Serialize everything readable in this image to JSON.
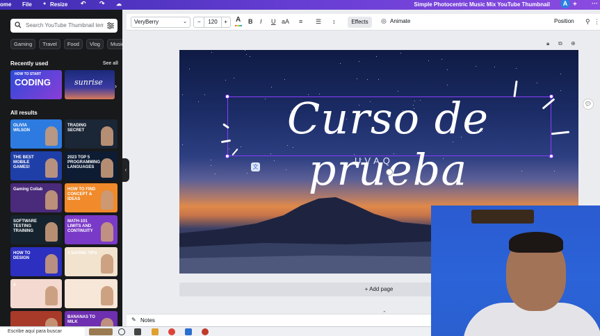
{
  "topbar": {
    "home_label": "ome",
    "file_label": "File",
    "resize_label": "Resize",
    "doc_title": "Simple Photocentric Music Mix YouTube Thumbnail",
    "avatar_letter": "A"
  },
  "left_panel": {
    "search_placeholder": "Search YouTube Thumbnail templ",
    "chips": [
      "Gaming",
      "Travel",
      "Food",
      "Vlog",
      "Music"
    ],
    "recently_used_title": "Recently used",
    "see_all_label": "See all",
    "all_results_title": "All results",
    "recent_thumbs": [
      {
        "text": "CODING",
        "small": "HOW TO START"
      },
      {
        "text": "sunrise",
        "small": ""
      }
    ],
    "result_thumbs": [
      {
        "text": "OLIVIA WILSON",
        "bg": "#2d7be0"
      },
      {
        "text": "TRADING SECRET",
        "bg": "#1b2636"
      },
      {
        "text": "THE BEST MOBILE GAMES!",
        "bg": "#1f3fa8"
      },
      {
        "text": "2023 TOP 5 PROGRAMMING LANGUAGES",
        "bg": "#0d1c33"
      },
      {
        "text": "Gaming Collab",
        "bg": "#4a2a7a"
      },
      {
        "text": "HOW TO FIND CONCEPT & IDEAS",
        "bg": "#f08a2a"
      },
      {
        "text": "SOFTWARE TESTING TRAINING",
        "bg": "#15232e"
      },
      {
        "text": "MATH-101 LIMITS AND CONTINUITY",
        "bg": "#7a3ac8"
      },
      {
        "text": "HOW TO DESIGN",
        "bg": "#2c2fc0"
      },
      {
        "text": "3 SAVING TIPS",
        "bg": "#f2e3cf"
      },
      {
        "text": "4",
        "bg": "#f3d9cf"
      },
      {
        "text": "",
        "bg": "#f7e7d8"
      },
      {
        "text": "",
        "bg": "#a83a2a"
      },
      {
        "text": "BANANAS TO MILK",
        "bg": "#6e2fb0"
      }
    ]
  },
  "toolbar": {
    "font_name": "VeryBerry",
    "font_size": "120",
    "effects_label": "Effects",
    "animate_label": "Animate",
    "position_label": "Position"
  },
  "design": {
    "title": "Curso de prueba",
    "subtitle": "UVAQ"
  },
  "add_page_label": "+ Add page",
  "notes_label": "Notes",
  "taskbar": {
    "search_text": "Escribe aquí para buscar"
  },
  "colors": {
    "brand_purple": "#8b3dff",
    "panel_bg": "#18191b"
  }
}
